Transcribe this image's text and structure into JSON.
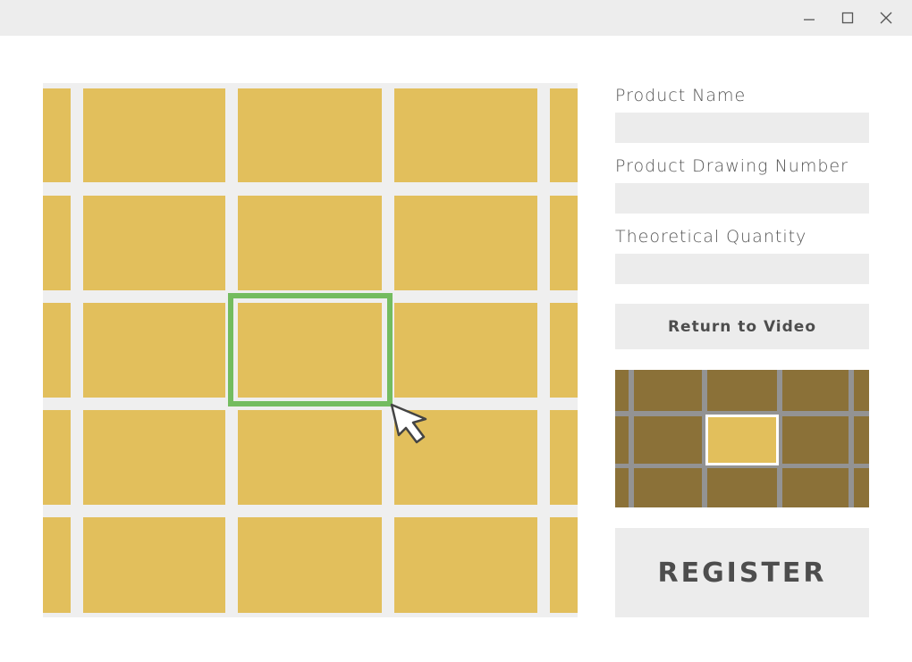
{
  "window": {
    "controls": [
      {
        "name": "minimize",
        "icon": "minimize-icon"
      },
      {
        "name": "maximize",
        "icon": "maximize-icon"
      },
      {
        "name": "close",
        "icon": "close-icon"
      }
    ]
  },
  "colors": {
    "cell": "#e2bf5c",
    "grid_bg": "#efefef",
    "selection": "#74bc5f",
    "minimap_cell": "#8b7138",
    "minimap_line": "#939393",
    "button_bg": "#ececec",
    "titlebar": "#ededed"
  },
  "grid_view": {
    "rows": 5,
    "columns": 5,
    "partial_columns": [
      "first",
      "last"
    ],
    "selected_cell": {
      "row": 3,
      "column": 3
    }
  },
  "form": {
    "fields": [
      {
        "label": "Product Name",
        "value": "",
        "placeholder": ""
      },
      {
        "label": "Product Drawing Number",
        "value": "",
        "placeholder": ""
      },
      {
        "label": "Theoretical Quantity",
        "value": "",
        "placeholder": ""
      }
    ],
    "return_button": "Return to Video",
    "register_button": "REGISTER"
  },
  "minimap": {
    "rows": 3,
    "columns": 5,
    "selected_cell": {
      "row": 2,
      "column": 3
    }
  }
}
